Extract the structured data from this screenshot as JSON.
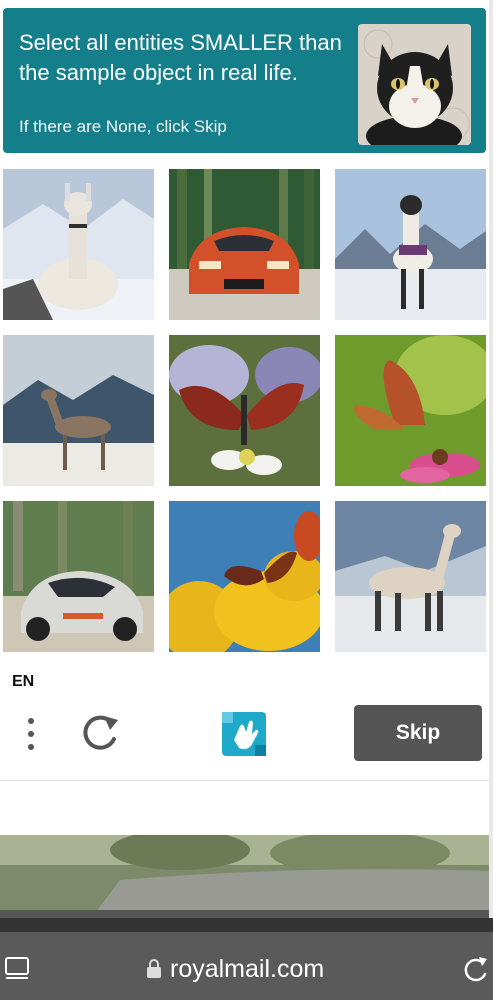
{
  "captcha": {
    "prompt": "Select all entities SMALLER than the sample object in real life.",
    "subprompt": "If there are None, click Skip",
    "sample_icon": "cat-photo",
    "tiles": [
      {
        "id": 1,
        "subject": "llama"
      },
      {
        "id": 2,
        "subject": "sports-car"
      },
      {
        "id": 3,
        "subject": "llama"
      },
      {
        "id": 4,
        "subject": "deer"
      },
      {
        "id": 5,
        "subject": "butterfly"
      },
      {
        "id": 6,
        "subject": "butterfly"
      },
      {
        "id": 7,
        "subject": "sports-car"
      },
      {
        "id": 8,
        "subject": "butterfly"
      },
      {
        "id": 9,
        "subject": "llama"
      }
    ]
  },
  "footer": {
    "language": "EN",
    "skip_label": "Skip"
  },
  "browser": {
    "url": "royalmail.com"
  },
  "colors": {
    "header_bg": "#147f8a",
    "skip_bg": "#555555",
    "browser_bar": "#5a5a5a"
  }
}
